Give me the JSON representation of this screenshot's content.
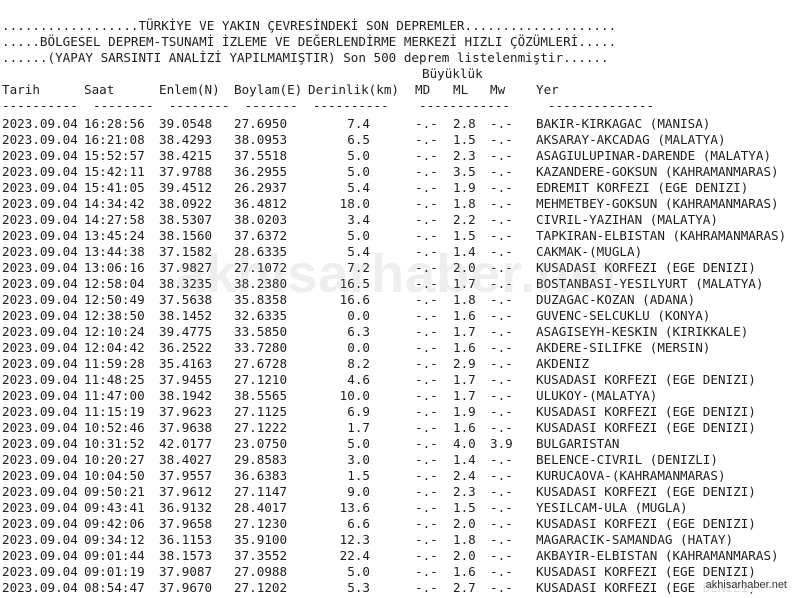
{
  "header": {
    "line1": "..................TÜRKİYE VE YAKIN ÇEVRESİNDEKİ SON DEPREMLER....................",
    "line2": ".....BÖLGESEL DEPREM-TSUNAMİ İZLEME VE DEĞERLENDİRME MERKEZİ HIZLI ÇÖZÜMLERİ.....",
    "line3": "......(YAPAY SARSINTI ANALİZİ YAPILMAMIŞTIR) Son 500 deprem listelenmiştir......"
  },
  "columns": {
    "buyukluk": "Büyüklük",
    "tarih": "Tarih",
    "saat": "Saat",
    "enlem": "Enlem(N)",
    "boylam": "Boylam(E)",
    "derinlik": "Derinlik(km)",
    "md": "MD",
    "ml": "ML",
    "mw": "Mw",
    "yer": "Yer",
    "separator": "----------  --------  --------  -------  ----------    ------------     --------------"
  },
  "rows": [
    {
      "date": "2023.09.04",
      "time": "16:28:56",
      "lat": "39.0548",
      "lon": "27.6950",
      "depth": "7.4",
      "md": "-.-",
      "ml": "2.8",
      "mw": "-.-",
      "loc": "BAKIR-KIRKAGAC (MANISA)"
    },
    {
      "date": "2023.09.04",
      "time": "16:21:08",
      "lat": "38.4293",
      "lon": "38.0953",
      "depth": "6.5",
      "md": "-.-",
      "ml": "1.5",
      "mw": "-.-",
      "loc": "AKSARAY-AKCADAG (MALATYA)"
    },
    {
      "date": "2023.09.04",
      "time": "15:52:57",
      "lat": "38.4215",
      "lon": "37.5518",
      "depth": "5.0",
      "md": "-.-",
      "ml": "2.3",
      "mw": "-.-",
      "loc": "ASAGIULUPINAR-DARENDE (MALATYA)"
    },
    {
      "date": "2023.09.04",
      "time": "15:42:11",
      "lat": "37.9788",
      "lon": "36.2955",
      "depth": "5.0",
      "md": "-.-",
      "ml": "3.5",
      "mw": "-.-",
      "loc": "KAZANDERE-GOKSUN (KAHRAMANMARAS)"
    },
    {
      "date": "2023.09.04",
      "time": "15:41:05",
      "lat": "39.4512",
      "lon": "26.2937",
      "depth": "5.4",
      "md": "-.-",
      "ml": "1.9",
      "mw": "-.-",
      "loc": "EDREMIT KORFEZI (EGE DENIZI)"
    },
    {
      "date": "2023.09.04",
      "time": "14:34:42",
      "lat": "38.0922",
      "lon": "36.4812",
      "depth": "18.0",
      "md": "-.-",
      "ml": "1.8",
      "mw": "-.-",
      "loc": "MEHMETBEY-GOKSUN (KAHRAMANMARAS)"
    },
    {
      "date": "2023.09.04",
      "time": "14:27:58",
      "lat": "38.5307",
      "lon": "38.0203",
      "depth": "3.4",
      "md": "-.-",
      "ml": "2.2",
      "mw": "-.-",
      "loc": "CIVRIL-YAZIHAN (MALATYA)"
    },
    {
      "date": "2023.09.04",
      "time": "13:45:24",
      "lat": "38.1560",
      "lon": "37.6372",
      "depth": "5.0",
      "md": "-.-",
      "ml": "1.5",
      "mw": "-.-",
      "loc": "TAPKIRAN-ELBISTAN (KAHRAMANMARAS)"
    },
    {
      "date": "2023.09.04",
      "time": "13:44:38",
      "lat": "37.1582",
      "lon": "28.6335",
      "depth": "5.4",
      "md": "-.-",
      "ml": "1.4",
      "mw": "-.-",
      "loc": "CAKMAK-(MUGLA)"
    },
    {
      "date": "2023.09.04",
      "time": "13:06:16",
      "lat": "37.9827",
      "lon": "27.1072",
      "depth": "7.2",
      "md": "-.-",
      "ml": "2.0",
      "mw": "-.-",
      "loc": "KUSADASI KORFEZI (EGE DENIZI)"
    },
    {
      "date": "2023.09.04",
      "time": "12:58:04",
      "lat": "38.3235",
      "lon": "38.2380",
      "depth": "16.5",
      "md": "-.-",
      "ml": "1.7",
      "mw": "-.-",
      "loc": "BOSTANBASI-YESILYURT (MALATYA)"
    },
    {
      "date": "2023.09.04",
      "time": "12:50:49",
      "lat": "37.5638",
      "lon": "35.8358",
      "depth": "16.6",
      "md": "-.-",
      "ml": "1.8",
      "mw": "-.-",
      "loc": "DUZAGAC-KOZAN (ADANA)"
    },
    {
      "date": "2023.09.04",
      "time": "12:38:50",
      "lat": "38.1452",
      "lon": "32.6335",
      "depth": "0.0",
      "md": "-.-",
      "ml": "1.6",
      "mw": "-.-",
      "loc": "GUVENC-SELCUKLU (KONYA)"
    },
    {
      "date": "2023.09.04",
      "time": "12:10:24",
      "lat": "39.4775",
      "lon": "33.5850",
      "depth": "6.3",
      "md": "-.-",
      "ml": "1.7",
      "mw": "-.-",
      "loc": "ASAGISEYH-KESKIN (KIRIKKALE)"
    },
    {
      "date": "2023.09.04",
      "time": "12:04:42",
      "lat": "36.2522",
      "lon": "33.7280",
      "depth": "0.0",
      "md": "-.-",
      "ml": "1.6",
      "mw": "-.-",
      "loc": "AKDERE-SILIFKE (MERSIN)"
    },
    {
      "date": "2023.09.04",
      "time": "11:59:28",
      "lat": "35.4163",
      "lon": "27.6728",
      "depth": "8.2",
      "md": "-.-",
      "ml": "2.9",
      "mw": "-.-",
      "loc": "AKDENIZ"
    },
    {
      "date": "2023.09.04",
      "time": "11:48:25",
      "lat": "37.9455",
      "lon": "27.1210",
      "depth": "4.6",
      "md": "-.-",
      "ml": "1.7",
      "mw": "-.-",
      "loc": "KUSADASI KORFEZI (EGE DENIZI)"
    },
    {
      "date": "2023.09.04",
      "time": "11:47:00",
      "lat": "38.1942",
      "lon": "38.5565",
      "depth": "10.0",
      "md": "-.-",
      "ml": "1.7",
      "mw": "-.-",
      "loc": "ULUKOY-(MALATYA)"
    },
    {
      "date": "2023.09.04",
      "time": "11:15:19",
      "lat": "37.9623",
      "lon": "27.1125",
      "depth": "6.9",
      "md": "-.-",
      "ml": "1.9",
      "mw": "-.-",
      "loc": "KUSADASI KORFEZI (EGE DENIZI)"
    },
    {
      "date": "2023.09.04",
      "time": "10:52:46",
      "lat": "37.9638",
      "lon": "27.1222",
      "depth": "1.7",
      "md": "-.-",
      "ml": "1.6",
      "mw": "-.-",
      "loc": "KUSADASI KORFEZI (EGE DENIZI)"
    },
    {
      "date": "2023.09.04",
      "time": "10:31:52",
      "lat": "42.0177",
      "lon": "23.0750",
      "depth": "5.0",
      "md": "-.-",
      "ml": "4.0",
      "mw": "3.9",
      "loc": "BULGARISTAN"
    },
    {
      "date": "2023.09.04",
      "time": "10:20:27",
      "lat": "38.4027",
      "lon": "29.8583",
      "depth": "3.0",
      "md": "-.-",
      "ml": "1.4",
      "mw": "-.-",
      "loc": "BELENCE-CIVRIL (DENIZLI)"
    },
    {
      "date": "2023.09.04",
      "time": "10:04:50",
      "lat": "37.9557",
      "lon": "36.6383",
      "depth": "1.5",
      "md": "-.-",
      "ml": "2.4",
      "mw": "-.-",
      "loc": "KURUCAOVA-(KAHRAMANMARAS)"
    },
    {
      "date": "2023.09.04",
      "time": "09:50:21",
      "lat": "37.9612",
      "lon": "27.1147",
      "depth": "9.0",
      "md": "-.-",
      "ml": "2.3",
      "mw": "-.-",
      "loc": "KUSADASI KORFEZI (EGE DENIZI)"
    },
    {
      "date": "2023.09.04",
      "time": "09:43:41",
      "lat": "36.9132",
      "lon": "28.4017",
      "depth": "13.6",
      "md": "-.-",
      "ml": "1.5",
      "mw": "-.-",
      "loc": "YESILCAM-ULA (MUGLA)"
    },
    {
      "date": "2023.09.04",
      "time": "09:42:06",
      "lat": "37.9658",
      "lon": "27.1230",
      "depth": "6.6",
      "md": "-.-",
      "ml": "2.0",
      "mw": "-.-",
      "loc": "KUSADASI KORFEZI (EGE DENIZI)"
    },
    {
      "date": "2023.09.04",
      "time": "09:34:12",
      "lat": "36.1153",
      "lon": "35.9100",
      "depth": "12.3",
      "md": "-.-",
      "ml": "1.8",
      "mw": "-.-",
      "loc": "MAGARACIK-SAMANDAG (HATAY)"
    },
    {
      "date": "2023.09.04",
      "time": "09:01:44",
      "lat": "38.1573",
      "lon": "37.3552",
      "depth": "22.4",
      "md": "-.-",
      "ml": "2.0",
      "mw": "-.-",
      "loc": "AKBAYIR-ELBISTAN (KAHRAMANMARAS)"
    },
    {
      "date": "2023.09.04",
      "time": "09:01:19",
      "lat": "37.9087",
      "lon": "27.0988",
      "depth": "5.0",
      "md": "-.-",
      "ml": "1.6",
      "mw": "-.-",
      "loc": "KUSADASI KORFEZI (EGE DENIZI)"
    },
    {
      "date": "2023.09.04",
      "time": "08:54:47",
      "lat": "37.9670",
      "lon": "27.1202",
      "depth": "5.3",
      "md": "-.-",
      "ml": "2.7",
      "mw": "-.-",
      "loc": "KUSADASI KORFEZI (EGE DENIZI)"
    }
  ],
  "watermark": "akhisarhaber.net",
  "corner_watermark": "akhisarhaber.net"
}
